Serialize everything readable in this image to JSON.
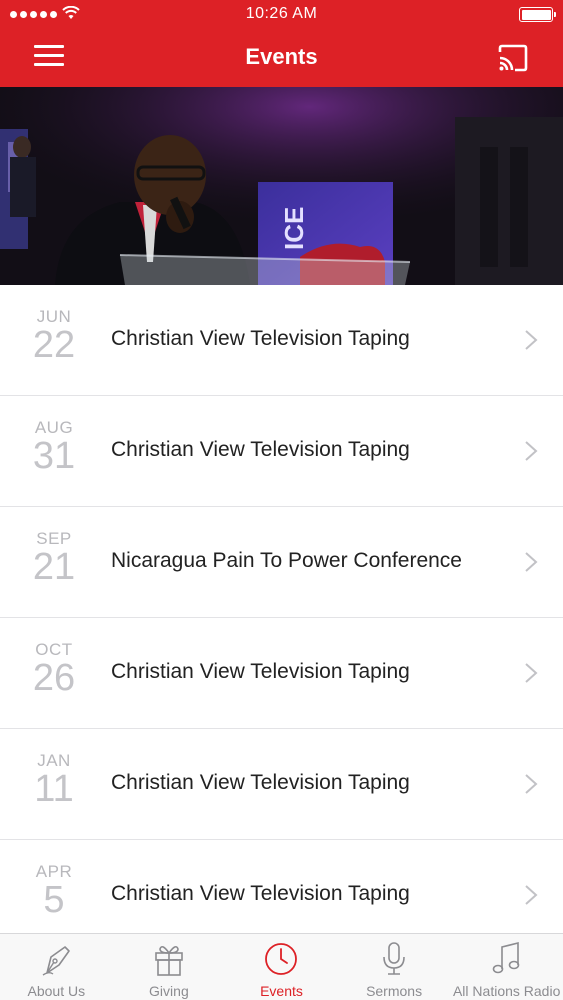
{
  "status_bar": {
    "time": "10:26 AM"
  },
  "nav": {
    "title": "Events"
  },
  "events": [
    {
      "month": "JUN",
      "day": "22",
      "title": "Christian View Television Taping"
    },
    {
      "month": "AUG",
      "day": "31",
      "title": "Christian View Television Taping"
    },
    {
      "month": "SEP",
      "day": "21",
      "title": "Nicaragua Pain To Power Conference"
    },
    {
      "month": "OCT",
      "day": "26",
      "title": "Christian View Television Taping"
    },
    {
      "month": "JAN",
      "day": "11",
      "title": "Christian View Television Taping"
    },
    {
      "month": "APR",
      "day": "5",
      "title": "Christian View Television Taping"
    }
  ],
  "tabs": [
    {
      "label": "About Us",
      "icon": "pen-nib-icon"
    },
    {
      "label": "Giving",
      "icon": "gift-icon"
    },
    {
      "label": "Events",
      "icon": "clock-icon",
      "active": true
    },
    {
      "label": "Sermons",
      "icon": "microphone-icon"
    },
    {
      "label": "All Nations Radio",
      "icon": "music-note-icon"
    }
  ],
  "colors": {
    "accent": "#dd2126",
    "tab_inactive": "#8c8c90",
    "date_gray": "#b8b8bc"
  }
}
